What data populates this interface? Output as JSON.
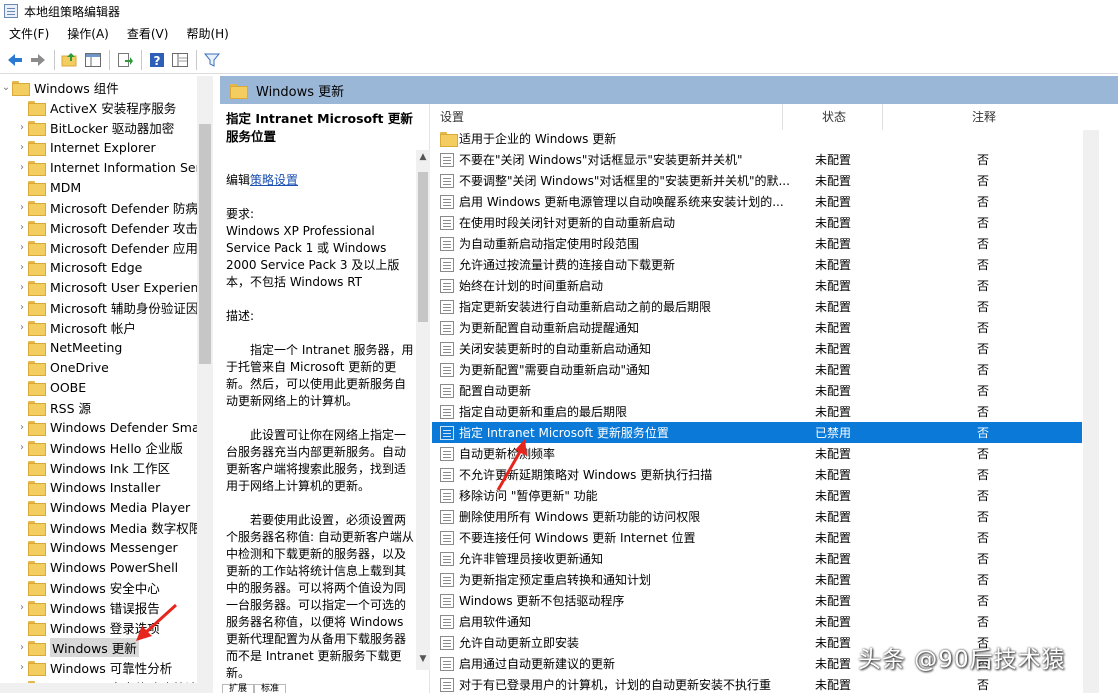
{
  "window": {
    "title": "本地组策略编辑器"
  },
  "menu": [
    "文件(F)",
    "操作(A)",
    "查看(V)",
    "帮助(H)"
  ],
  "toolbar_icons": [
    "back-arrow-icon",
    "forward-arrow-icon",
    "up-folder-icon",
    "show-hide-tree-icon",
    "export-list-icon",
    "help-icon",
    "extended-view-icon",
    "filter-icon"
  ],
  "tree": {
    "root": "Windows 组件",
    "items": [
      "ActiveX 安装程序服务",
      "BitLocker 驱动器加密",
      "Internet Explorer",
      "Internet Information Serv",
      "MDM",
      "Microsoft Defender 防病",
      "Microsoft Defender 攻击",
      "Microsoft Defender 应用",
      "Microsoft Edge",
      "Microsoft User Experienc",
      "Microsoft 辅助身份验证因",
      "Microsoft 帐户",
      "NetMeeting",
      "OneDrive",
      "OOBE",
      "RSS 源",
      "Windows Defender Smar",
      "Windows Hello 企业版",
      "Windows Ink 工作区",
      "Windows Installer",
      "Windows Media Player",
      "Windows Media 数字权限",
      "Windows Messenger",
      "Windows PowerShell",
      "Windows 安全中心",
      "Windows 错误报告",
      "Windows 登录选项",
      "Windows 更新",
      "Windows 可靠性分析",
      "Windows 客户体验改善计"
    ],
    "selected_index": 27
  },
  "pane_header": "Windows 更新",
  "description": {
    "title": "指定 Intranet Microsoft 更新服务位置",
    "edit_prefix": "编辑",
    "edit_link": "策略设置",
    "requirements_label": "要求:",
    "requirements": "Windows XP Professional Service Pack 1 或 Windows 2000 Service Pack 3 及以上版本，不包括 Windows RT",
    "description_label": "描述:",
    "para1": "指定一个 Intranet 服务器，用于托管来自 Microsoft 更新的更新。然后，可以使用此更新服务自动更新网络上的计算机。",
    "para2": "此设置可让你在网络上指定一台服务器充当内部更新服务。自动更新客户端将搜索此服务，找到适用于网络上计算机的更新。",
    "para3": "若要使用此设置，必须设置两个服务器名称值: 自动更新客户端从中检测和下载更新的服务器，以及更新的工作站将统计信息上载到其中的服务器。可以将两个值设为同一台服务器。可以指定一个可选的服务器名称值，以便将 Windows 更新代理配置为从备用下载服务器而不是 Intranet 更新服务下载更新。"
  },
  "columns": {
    "setting": "设置",
    "state": "状态",
    "comment": "注释"
  },
  "settings": [
    {
      "name": "适用于企业的 Windows 更新",
      "state": "",
      "comment": "",
      "folder": true
    },
    {
      "name": "不要在\"关闭 Windows\"对话框显示\"安装更新并关机\"",
      "state": "未配置",
      "comment": "否"
    },
    {
      "name": "不要调整\"关闭 Windows\"对话框里的\"安装更新并关机\"的默...",
      "state": "未配置",
      "comment": "否"
    },
    {
      "name": "启用 Windows 更新电源管理以自动唤醒系统来安装计划的...",
      "state": "未配置",
      "comment": "否"
    },
    {
      "name": "在使用时段关闭针对更新的自动重新启动",
      "state": "未配置",
      "comment": "否"
    },
    {
      "name": "为自动重新启动指定使用时段范围",
      "state": "未配置",
      "comment": "否"
    },
    {
      "name": "允许通过按流量计费的连接自动下载更新",
      "state": "未配置",
      "comment": "否"
    },
    {
      "name": "始终在计划的时间重新启动",
      "state": "未配置",
      "comment": "否"
    },
    {
      "name": "指定更新安装进行自动重新启动之前的最后期限",
      "state": "未配置",
      "comment": "否"
    },
    {
      "name": "为更新配置自动重新启动提醒通知",
      "state": "未配置",
      "comment": "否"
    },
    {
      "name": "关闭安装更新时的自动重新启动通知",
      "state": "未配置",
      "comment": "否"
    },
    {
      "name": "为更新配置\"需要自动重新启动\"通知",
      "state": "未配置",
      "comment": "否"
    },
    {
      "name": "配置自动更新",
      "state": "未配置",
      "comment": "否"
    },
    {
      "name": "指定自动更新和重启的最后期限",
      "state": "未配置",
      "comment": "否"
    },
    {
      "name": "指定 Intranet Microsoft 更新服务位置",
      "state": "已禁用",
      "comment": "否",
      "selected": true
    },
    {
      "name": "自动更新检测频率",
      "state": "未配置",
      "comment": "否"
    },
    {
      "name": "不允许更新延期策略对 Windows 更新执行扫描",
      "state": "未配置",
      "comment": "否"
    },
    {
      "name": "移除访问 \"暂停更新\" 功能",
      "state": "未配置",
      "comment": "否"
    },
    {
      "name": "删除使用所有 Windows 更新功能的访问权限",
      "state": "未配置",
      "comment": "否"
    },
    {
      "name": "不要连接任何 Windows 更新 Internet 位置",
      "state": "未配置",
      "comment": "否"
    },
    {
      "name": "允许非管理员接收更新通知",
      "state": "未配置",
      "comment": "否"
    },
    {
      "name": "为更新指定预定重启转换和通知计划",
      "state": "未配置",
      "comment": "否"
    },
    {
      "name": "Windows 更新不包括驱动程序",
      "state": "未配置",
      "comment": "否"
    },
    {
      "name": "启用软件通知",
      "state": "未配置",
      "comment": "否"
    },
    {
      "name": "允许自动更新立即安装",
      "state": "未配置",
      "comment": "否"
    },
    {
      "name": "启用通过自动更新建议的更新",
      "state": "未配置",
      "comment": "否"
    },
    {
      "name": "对于有已登录用户的计算机，计划的自动更新安装不执行重",
      "state": "未配置",
      "comment": "否"
    }
  ],
  "tabs": [
    "扩展",
    "标准"
  ],
  "watermark": "头条 @90后技术猿",
  "colors": {
    "selection": "#0a79d8",
    "header": "#9bb7d8",
    "arrow": "#e8251d"
  }
}
